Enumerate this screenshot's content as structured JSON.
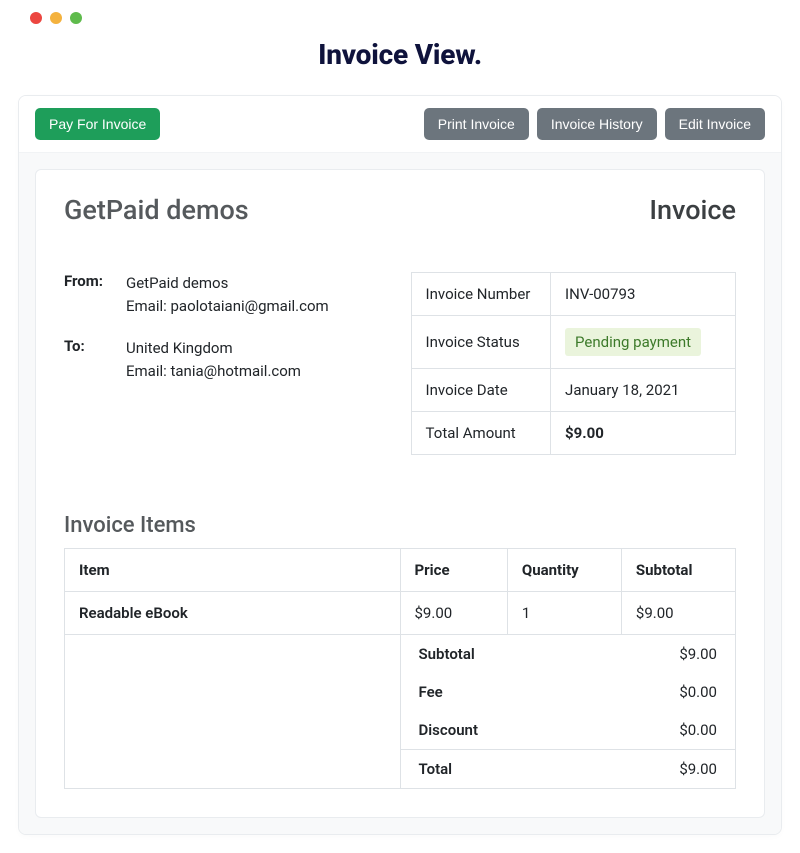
{
  "page_title": "Invoice View.",
  "toolbar": {
    "pay": "Pay For Invoice",
    "print": "Print Invoice",
    "history": "Invoice History",
    "edit": "Edit Invoice"
  },
  "company_name": "GetPaid demos",
  "document_type": "Invoice",
  "from": {
    "label": "From:",
    "name": "GetPaid demos",
    "email_line": "Email: paolotaiani@gmail.com"
  },
  "to": {
    "label": "To:",
    "name": "United Kingdom",
    "email_line": "Email: tania@hotmail.com"
  },
  "summary": {
    "number_label": "Invoice Number",
    "number_value": "INV-00793",
    "status_label": "Invoice Status",
    "status_value": "Pending payment",
    "date_label": "Invoice Date",
    "date_value": "January 18, 2021",
    "amount_label": "Total Amount",
    "amount_value": "$9.00"
  },
  "items_title": "Invoice Items",
  "items_headers": {
    "item": "Item",
    "price": "Price",
    "quantity": "Quantity",
    "subtotal": "Subtotal"
  },
  "items": [
    {
      "name": "Readable eBook",
      "price": "$9.00",
      "quantity": "1",
      "subtotal": "$9.00"
    }
  ],
  "totals": {
    "subtotal_label": "Subtotal",
    "subtotal_value": "$9.00",
    "fee_label": "Fee",
    "fee_value": "$0.00",
    "discount_label": "Discount",
    "discount_value": "$0.00",
    "total_label": "Total",
    "total_value": "$9.00"
  }
}
